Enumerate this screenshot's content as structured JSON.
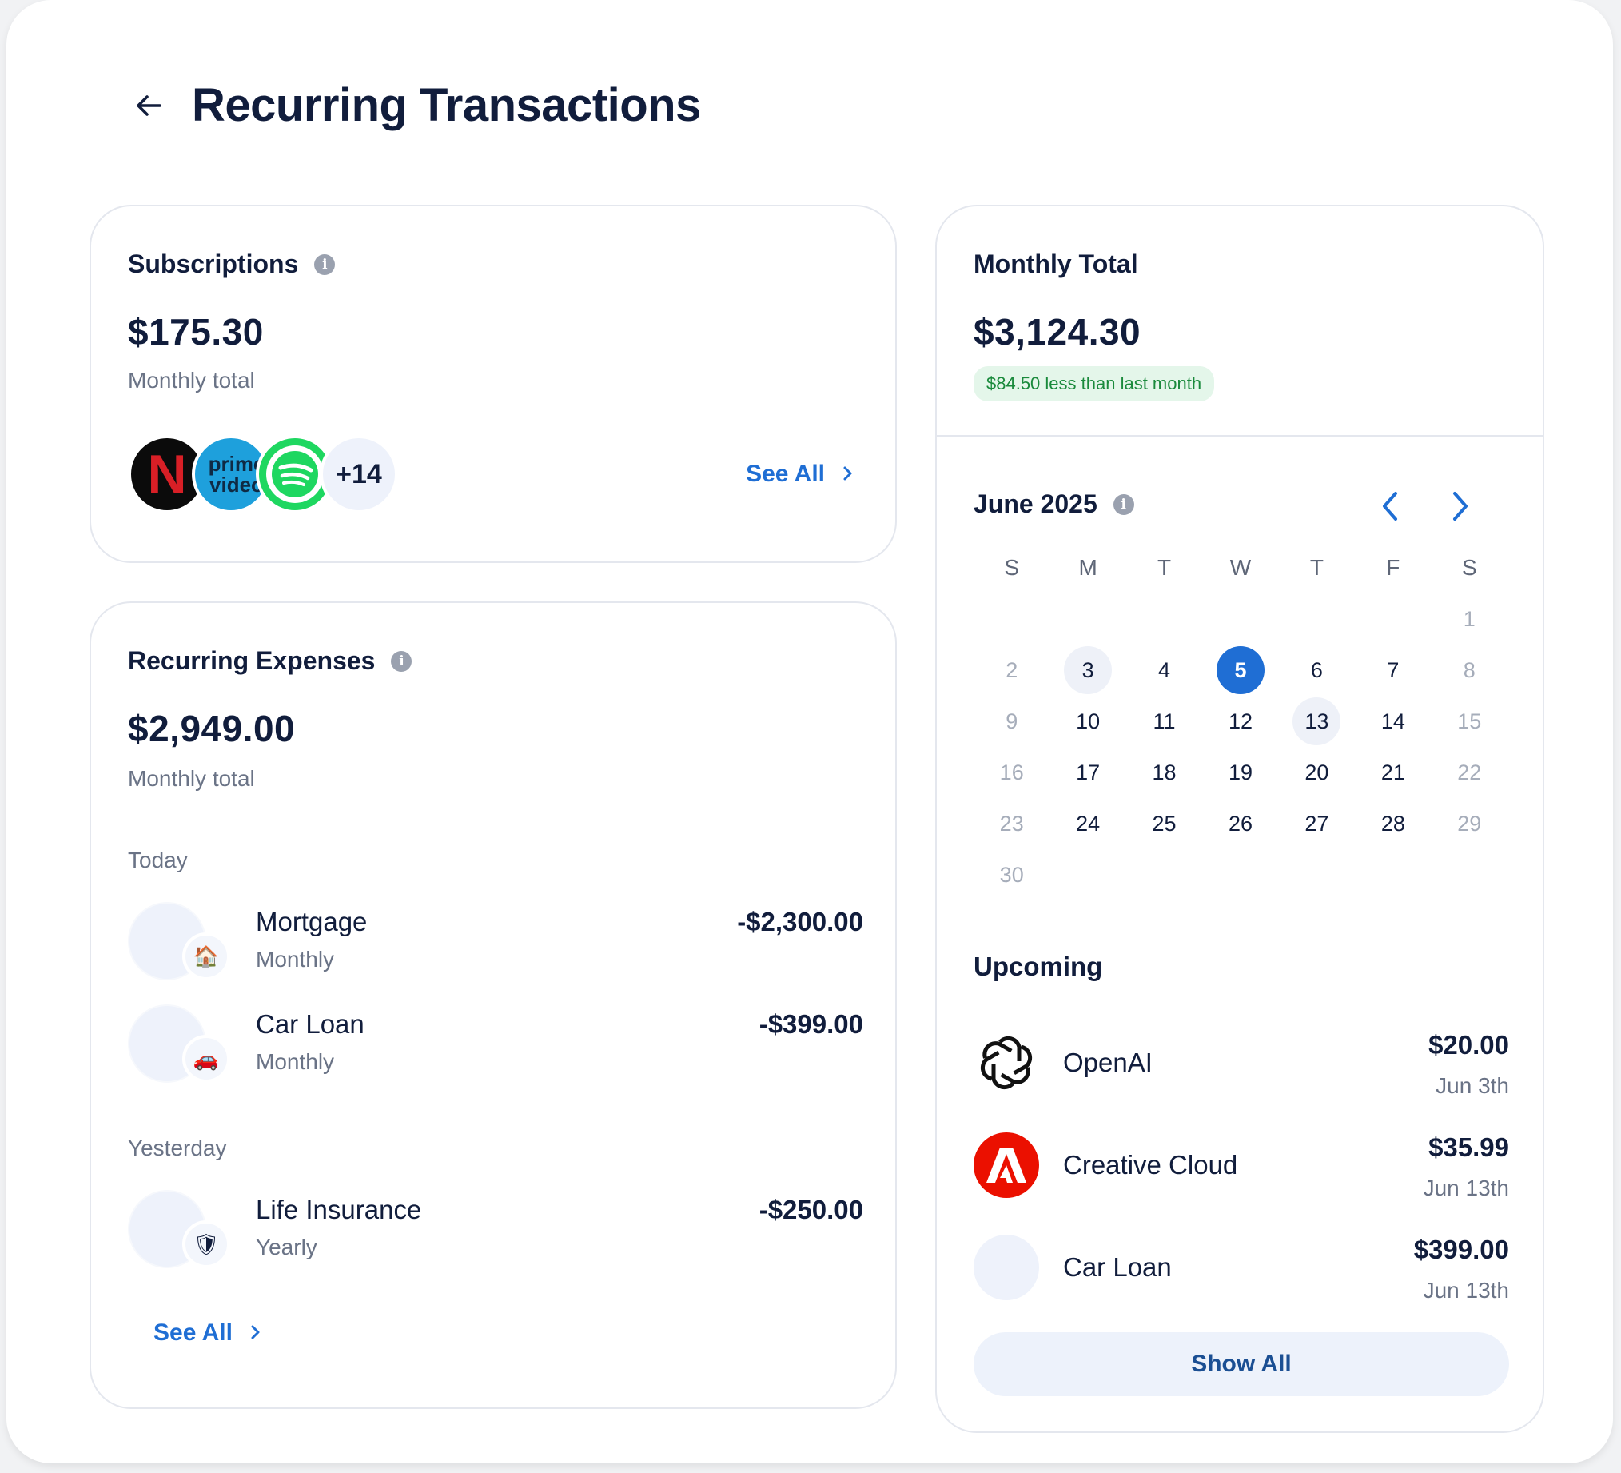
{
  "header": {
    "title": "Recurring Transactions"
  },
  "subscriptions": {
    "title": "Subscriptions",
    "amount": "$175.30",
    "caption": "Monthly total",
    "logos": [
      "netflix-logo",
      "prime-video-logo",
      "spotify-logo"
    ],
    "prime_text_1": "prime",
    "prime_text_2": "video",
    "netflix_letter": "N",
    "more_count": "+14",
    "see_all": "See All"
  },
  "expenses": {
    "title": "Recurring Expenses",
    "amount": "$2,949.00",
    "caption": "Monthly total",
    "groups": [
      {
        "label": "Today",
        "items": [
          {
            "name": "Mortgage",
            "frequency": "Monthly",
            "amount": "-$2,300.00",
            "emoji": "🏠"
          },
          {
            "name": "Car Loan",
            "frequency": "Monthly",
            "amount": "-$399.00",
            "emoji": "🚗"
          }
        ]
      },
      {
        "label": "Yesterday",
        "items": [
          {
            "name": "Life Insurance",
            "frequency": "Yearly",
            "amount": "-$250.00",
            "emoji": "🛡"
          }
        ]
      }
    ],
    "see_all": "See All"
  },
  "monthly_total": {
    "title": "Monthly Total",
    "amount": "$3,124.30",
    "delta": "$84.50 less than last month"
  },
  "calendar": {
    "month_label": "June 2025",
    "weekdays": [
      "S",
      "M",
      "T",
      "W",
      "T",
      "F",
      "S"
    ],
    "days": [
      "",
      "",
      "",
      "",
      "",
      "",
      "1",
      "2",
      "3",
      "4",
      "5",
      "6",
      "7",
      "8",
      "9",
      "10",
      "11",
      "12",
      "13",
      "14",
      "15",
      "16",
      "17",
      "18",
      "19",
      "20",
      "21",
      "22",
      "23",
      "24",
      "25",
      "26",
      "27",
      "28",
      "29",
      "30"
    ],
    "selected_day": "5",
    "marked_days": [
      "3",
      "13"
    ]
  },
  "upcoming": {
    "title": "Upcoming",
    "items": [
      {
        "name": "OpenAI",
        "amount": "$20.00",
        "date": "Jun 3th",
        "logo": "openai-logo"
      },
      {
        "name": "Creative Cloud",
        "amount": "$35.99",
        "date": "Jun 13th",
        "logo": "adobe-logo"
      },
      {
        "name": "Car Loan",
        "amount": "$399.00",
        "date": "Jun 13th",
        "logo": "placeholder"
      }
    ],
    "show_all": "Show All"
  },
  "colors": {
    "accent": "#1f6ed4",
    "text": "#111d3c",
    "muted": "#6a7386",
    "positive_bg": "#e4f6ea",
    "positive_text": "#1a8a3c"
  }
}
